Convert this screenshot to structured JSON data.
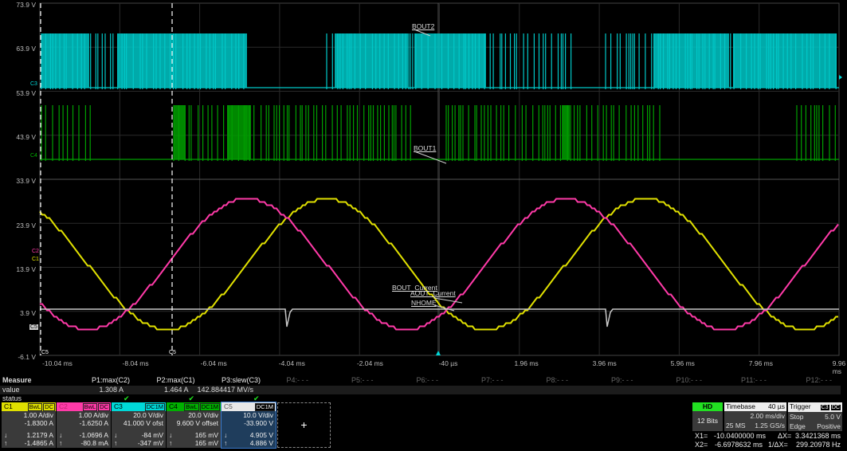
{
  "axes": {
    "y_labels": [
      "73.9 V",
      "63.9 V",
      "53.9 V",
      "43.9 V",
      "33.9 V",
      "23.9 V",
      "13.9 V",
      "3.9 V",
      "-6.1 V"
    ],
    "x_labels": [
      "-10.04 ms",
      "-8.04 ms",
      "-6.04 ms",
      "-4.04 ms",
      "-2.04 ms",
      "-40 µs",
      "1.96 ms",
      "3.96 ms",
      "5.96 ms",
      "7.96 ms",
      "9.96 ms"
    ]
  },
  "trace_labels": {
    "bout2": "BOUT2",
    "bout1": "BOUT1",
    "bout_current": "BOUT_Current",
    "aout_current": "AOUT_Current",
    "nhome": "NHOME"
  },
  "channel_markers": {
    "c1": "C1",
    "c2": "C2",
    "c3": "C3",
    "c4": "C4",
    "c5": "C5",
    "cursor1": "C5",
    "cursor2": "C5"
  },
  "colors": {
    "c1": "#e0e000",
    "c2": "#ff3aa8",
    "c3": "#00d8d8",
    "c4": "#00b000",
    "c5": "#c8c8c8"
  },
  "measure": {
    "title": "Measure",
    "value_label": "value",
    "status_label": "status",
    "params": [
      {
        "name": "P1:max(C2)",
        "value": "1.308 A",
        "status": "✔"
      },
      {
        "name": "P2:max(C1)",
        "value": "1.464 A",
        "status": "✔"
      },
      {
        "name": "P3:slew(C3)",
        "value": "142.884417 MV/s",
        "status": "✔"
      },
      {
        "name": "P4:- - -"
      },
      {
        "name": "P5:- - -"
      },
      {
        "name": "P6:- - -"
      },
      {
        "name": "P7:- - -"
      },
      {
        "name": "P8:- - -"
      },
      {
        "name": "P9:- - -"
      },
      {
        "name": "P10:- - -"
      },
      {
        "name": "P11:- - -"
      },
      {
        "name": "P12:- - -"
      }
    ]
  },
  "channels": [
    {
      "id": "C1",
      "tags": [
        "BwL",
        "DC"
      ],
      "scale": "1.00 A/div",
      "offset": "-1.8300 A",
      "down": "1.2179 A",
      "up": "-1.4865 A"
    },
    {
      "id": "C2",
      "tags": [
        "BwL",
        "DC"
      ],
      "scale": "1.00 A/div",
      "offset": "-1.6250 A",
      "down": "-1.0696 A",
      "up": "-80.8 mA"
    },
    {
      "id": "C3",
      "tags": [
        "DC1M"
      ],
      "scale": "20.0 V/div",
      "offset": "41.000 V ofst",
      "down": "-84 mV",
      "up": "-347 mV"
    },
    {
      "id": "C4",
      "tags": [
        "BwL",
        "DC1M"
      ],
      "scale": "20.0 V/div",
      "offset": "9.600 V offset",
      "down": "165 mV",
      "up": "165 mV"
    },
    {
      "id": "C5",
      "tags": [
        "DC1M"
      ],
      "scale": "10.0 V/div",
      "offset": "-33.900 V",
      "down": "4.905 V",
      "up": "4.886 V"
    }
  ],
  "arrows": {
    "down": "↓",
    "up": "↑"
  },
  "add_channel": "+",
  "acq": {
    "mode": "HD",
    "bits": "12 Bits"
  },
  "timebase": {
    "title": "Timebase",
    "delay": "40 µs",
    "div": "2.00 ms/div",
    "samples": "25 MS",
    "rate": "1.25 GS/s"
  },
  "trigger": {
    "title": "Trigger",
    "source": "C3",
    "coupling": "DC",
    "mode": "Stop",
    "level": "5.0 V",
    "type": "Edge",
    "slope": "Positive"
  },
  "cursors": {
    "x1_label": "X1=",
    "x1": "-10.0400000 ms",
    "dx_label": "ΔX=",
    "dx": "3.3421368 ms",
    "x2_label": "X2=",
    "x2": "-6.6978632 ms",
    "inv_label": "1/ΔX=",
    "inv": "299.20978 Hz"
  }
}
